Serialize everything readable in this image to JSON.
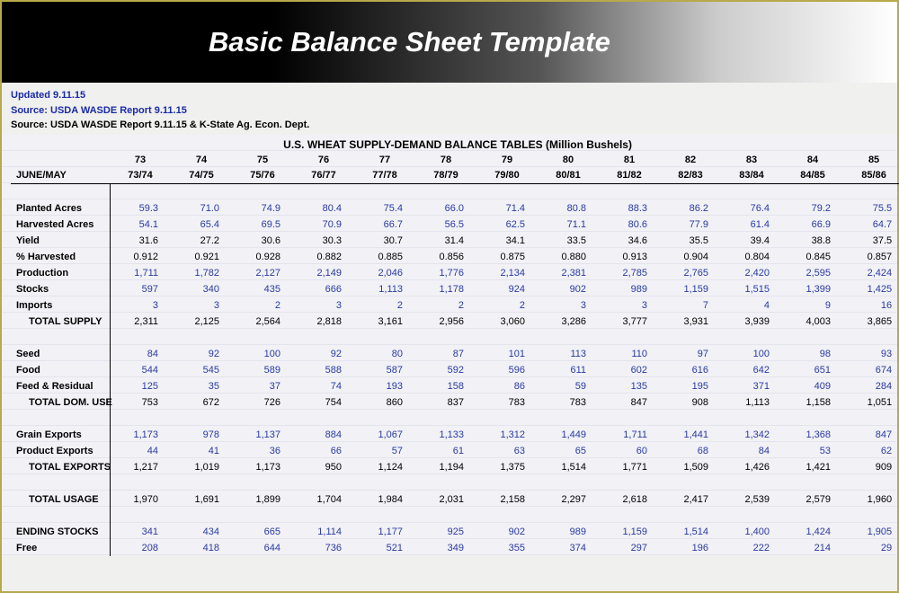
{
  "banner_title": "Basic Balance Sheet Template",
  "meta": {
    "updated": "Updated 9.11.15",
    "source1": "Source:  USDA WASDE Report 9.11.15",
    "source2": "Source:  USDA WASDE Report 9.11.15 & K-State Ag. Econ. Dept."
  },
  "table_title": "U.S. WHEAT SUPPLY-DEMAND BALANCE TABLES (Million Bushels)",
  "row_header": "JUNE/MAY",
  "years": [
    "73",
    "74",
    "75",
    "76",
    "77",
    "78",
    "79",
    "80",
    "81",
    "82",
    "83",
    "84",
    "85"
  ],
  "seasons": [
    "73/74",
    "74/75",
    "75/76",
    "76/77",
    "77/78",
    "78/79",
    "79/80",
    "80/81",
    "81/82",
    "82/83",
    "83/84",
    "84/85",
    "85/86"
  ],
  "rows": [
    {
      "label": "Planted Acres",
      "style": "blue",
      "indent": false,
      "v": [
        "59.3",
        "71.0",
        "74.9",
        "80.4",
        "75.4",
        "66.0",
        "71.4",
        "80.8",
        "88.3",
        "86.2",
        "76.4",
        "79.2",
        "75.5"
      ]
    },
    {
      "label": "Harvested Acres",
      "style": "blue",
      "indent": false,
      "v": [
        "54.1",
        "65.4",
        "69.5",
        "70.9",
        "66.7",
        "56.5",
        "62.5",
        "71.1",
        "80.6",
        "77.9",
        "61.4",
        "66.9",
        "64.7"
      ]
    },
    {
      "label": "Yield",
      "style": "black",
      "indent": false,
      "v": [
        "31.6",
        "27.2",
        "30.6",
        "30.3",
        "30.7",
        "31.4",
        "34.1",
        "33.5",
        "34.6",
        "35.5",
        "39.4",
        "38.8",
        "37.5"
      ]
    },
    {
      "label": "% Harvested",
      "style": "black",
      "indent": false,
      "v": [
        "0.912",
        "0.921",
        "0.928",
        "0.882",
        "0.885",
        "0.856",
        "0.875",
        "0.880",
        "0.913",
        "0.904",
        "0.804",
        "0.845",
        "0.857"
      ]
    },
    {
      "label": "Production",
      "style": "blue",
      "indent": false,
      "v": [
        "1,711",
        "1,782",
        "2,127",
        "2,149",
        "2,046",
        "1,776",
        "2,134",
        "2,381",
        "2,785",
        "2,765",
        "2,420",
        "2,595",
        "2,424"
      ]
    },
    {
      "label": "Stocks",
      "style": "blue",
      "indent": false,
      "v": [
        "597",
        "340",
        "435",
        "666",
        "1,113",
        "1,178",
        "924",
        "902",
        "989",
        "1,159",
        "1,515",
        "1,399",
        "1,425"
      ]
    },
    {
      "label": "Imports",
      "style": "blue",
      "indent": false,
      "v": [
        "3",
        "3",
        "2",
        "3",
        "2",
        "2",
        "2",
        "3",
        "3",
        "7",
        "4",
        "9",
        "16"
      ]
    },
    {
      "label": "TOTAL SUPPLY",
      "style": "black",
      "indent": true,
      "v": [
        "2,311",
        "2,125",
        "2,564",
        "2,818",
        "3,161",
        "2,956",
        "3,060",
        "3,286",
        "3,777",
        "3,931",
        "3,939",
        "4,003",
        "3,865"
      ]
    },
    {
      "spacer": true
    },
    {
      "label": "Seed",
      "style": "blue",
      "indent": false,
      "v": [
        "84",
        "92",
        "100",
        "92",
        "80",
        "87",
        "101",
        "113",
        "110",
        "97",
        "100",
        "98",
        "93"
      ]
    },
    {
      "label": "Food",
      "style": "blue",
      "indent": false,
      "v": [
        "544",
        "545",
        "589",
        "588",
        "587",
        "592",
        "596",
        "611",
        "602",
        "616",
        "642",
        "651",
        "674"
      ]
    },
    {
      "label": "Feed & Residual",
      "style": "blue",
      "indent": false,
      "v": [
        "125",
        "35",
        "37",
        "74",
        "193",
        "158",
        "86",
        "59",
        "135",
        "195",
        "371",
        "409",
        "284"
      ]
    },
    {
      "label": "TOTAL DOM. USE",
      "style": "black",
      "indent": true,
      "v": [
        "753",
        "672",
        "726",
        "754",
        "860",
        "837",
        "783",
        "783",
        "847",
        "908",
        "1,113",
        "1,158",
        "1,051"
      ]
    },
    {
      "spacer": true
    },
    {
      "label": "Grain Exports",
      "style": "blue",
      "indent": false,
      "v": [
        "1,173",
        "978",
        "1,137",
        "884",
        "1,067",
        "1,133",
        "1,312",
        "1,449",
        "1,711",
        "1,441",
        "1,342",
        "1,368",
        "847"
      ]
    },
    {
      "label": "Product Exports",
      "style": "blue",
      "indent": false,
      "v": [
        "44",
        "41",
        "36",
        "66",
        "57",
        "61",
        "63",
        "65",
        "60",
        "68",
        "84",
        "53",
        "62"
      ]
    },
    {
      "label": "TOTAL EXPORTS",
      "style": "black",
      "indent": true,
      "v": [
        "1,217",
        "1,019",
        "1,173",
        "950",
        "1,124",
        "1,194",
        "1,375",
        "1,514",
        "1,771",
        "1,509",
        "1,426",
        "1,421",
        "909"
      ]
    },
    {
      "spacer": true
    },
    {
      "label": "TOTAL USAGE",
      "style": "black",
      "indent": true,
      "v": [
        "1,970",
        "1,691",
        "1,899",
        "1,704",
        "1,984",
        "2,031",
        "2,158",
        "2,297",
        "2,618",
        "2,417",
        "2,539",
        "2,579",
        "1,960"
      ]
    },
    {
      "spacer": true
    },
    {
      "label": "ENDING STOCKS",
      "style": "blue",
      "indent": false,
      "v": [
        "341",
        "434",
        "665",
        "1,114",
        "1,177",
        "925",
        "902",
        "989",
        "1,159",
        "1,514",
        "1,400",
        "1,424",
        "1,905"
      ]
    },
    {
      "label": "Free",
      "style": "blue",
      "indent": false,
      "v": [
        "208",
        "418",
        "644",
        "736",
        "521",
        "349",
        "355",
        "374",
        "297",
        "196",
        "222",
        "214",
        "29"
      ]
    }
  ]
}
